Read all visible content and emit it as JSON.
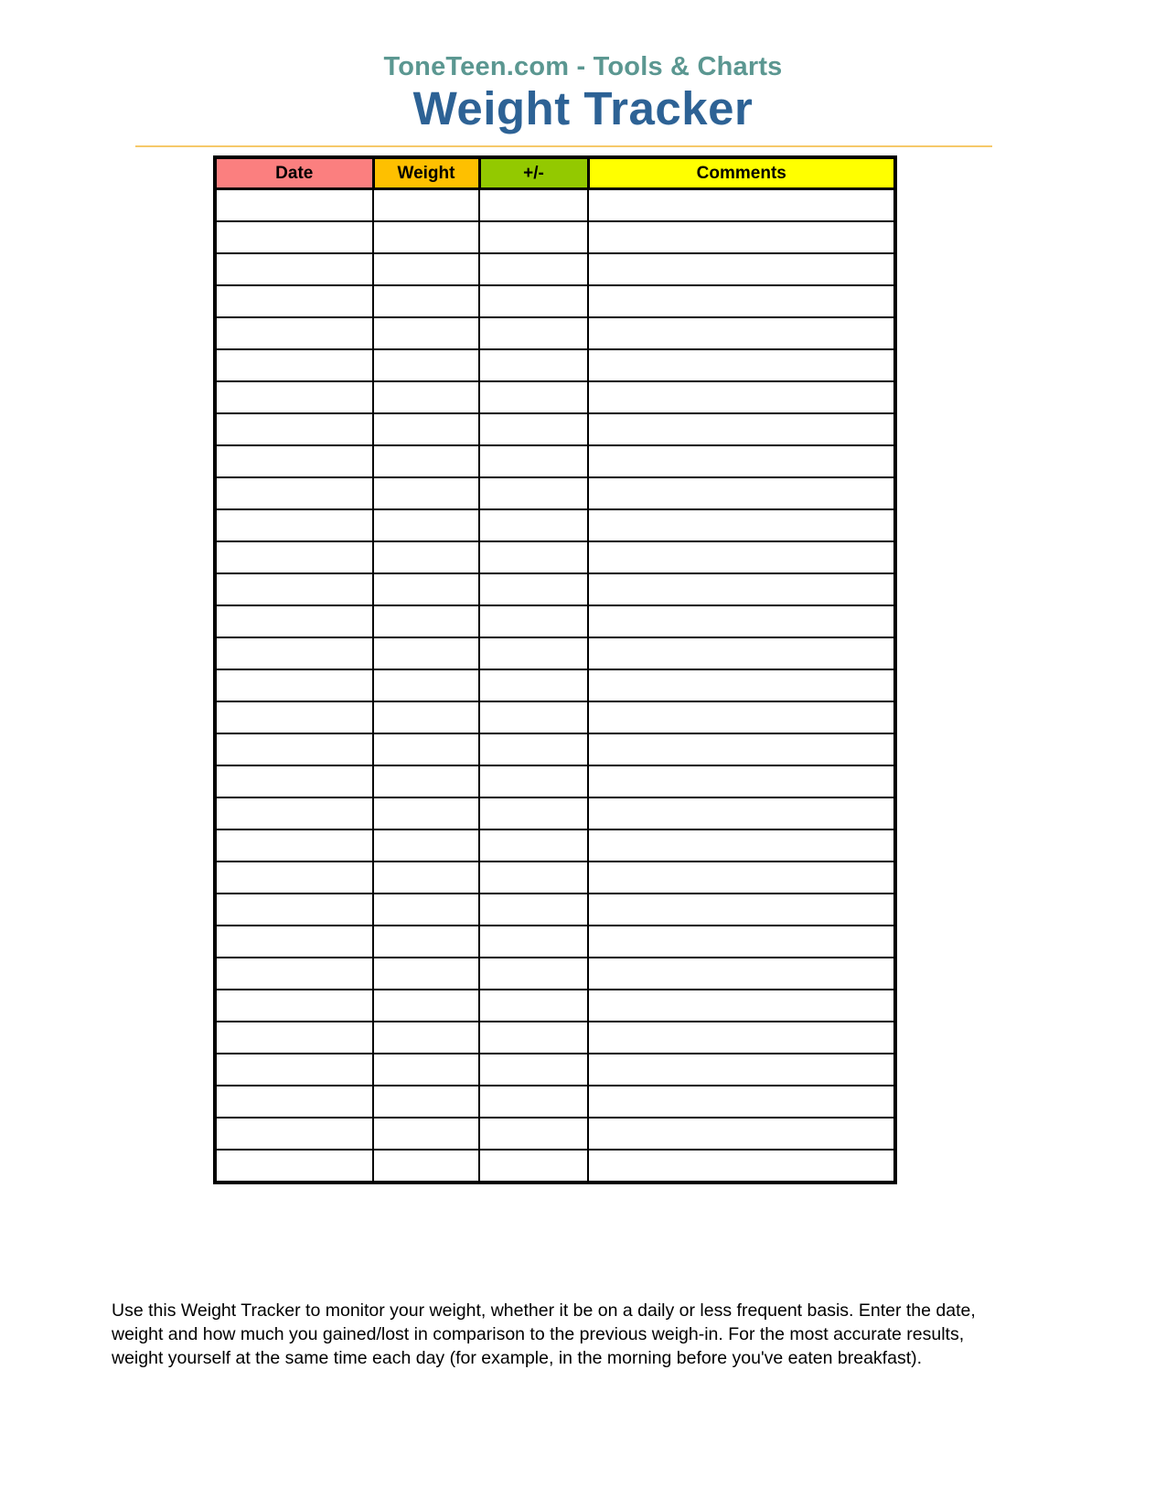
{
  "document": {
    "brand_line": "ToneTeen.com - Tools & Charts",
    "title": "Weight Tracker"
  },
  "theme": {
    "brand_color": "#5b9791",
    "title_color": "#2d6295",
    "rule_color": "#f6c96a",
    "header_date_bg": "#fb7f7f",
    "header_weight_bg": "#fec000",
    "header_delta_bg": "#93c900",
    "header_comments_bg": "#ffff00",
    "grid_color": "#000000",
    "cell_bg": "#ffffff"
  },
  "table": {
    "columns": [
      {
        "key": "date",
        "label": "Date"
      },
      {
        "key": "weight",
        "label": "Weight"
      },
      {
        "key": "delta",
        "label": "+/-"
      },
      {
        "key": "comments",
        "label": "Comments"
      }
    ],
    "row_count": 31,
    "rows": [
      {
        "date": "",
        "weight": "",
        "delta": "",
        "comments": ""
      },
      {
        "date": "",
        "weight": "",
        "delta": "",
        "comments": ""
      },
      {
        "date": "",
        "weight": "",
        "delta": "",
        "comments": ""
      },
      {
        "date": "",
        "weight": "",
        "delta": "",
        "comments": ""
      },
      {
        "date": "",
        "weight": "",
        "delta": "",
        "comments": ""
      },
      {
        "date": "",
        "weight": "",
        "delta": "",
        "comments": ""
      },
      {
        "date": "",
        "weight": "",
        "delta": "",
        "comments": ""
      },
      {
        "date": "",
        "weight": "",
        "delta": "",
        "comments": ""
      },
      {
        "date": "",
        "weight": "",
        "delta": "",
        "comments": ""
      },
      {
        "date": "",
        "weight": "",
        "delta": "",
        "comments": ""
      },
      {
        "date": "",
        "weight": "",
        "delta": "",
        "comments": ""
      },
      {
        "date": "",
        "weight": "",
        "delta": "",
        "comments": ""
      },
      {
        "date": "",
        "weight": "",
        "delta": "",
        "comments": ""
      },
      {
        "date": "",
        "weight": "",
        "delta": "",
        "comments": ""
      },
      {
        "date": "",
        "weight": "",
        "delta": "",
        "comments": ""
      },
      {
        "date": "",
        "weight": "",
        "delta": "",
        "comments": ""
      },
      {
        "date": "",
        "weight": "",
        "delta": "",
        "comments": ""
      },
      {
        "date": "",
        "weight": "",
        "delta": "",
        "comments": ""
      },
      {
        "date": "",
        "weight": "",
        "delta": "",
        "comments": ""
      },
      {
        "date": "",
        "weight": "",
        "delta": "",
        "comments": ""
      },
      {
        "date": "",
        "weight": "",
        "delta": "",
        "comments": ""
      },
      {
        "date": "",
        "weight": "",
        "delta": "",
        "comments": ""
      },
      {
        "date": "",
        "weight": "",
        "delta": "",
        "comments": ""
      },
      {
        "date": "",
        "weight": "",
        "delta": "",
        "comments": ""
      },
      {
        "date": "",
        "weight": "",
        "delta": "",
        "comments": ""
      },
      {
        "date": "",
        "weight": "",
        "delta": "",
        "comments": ""
      },
      {
        "date": "",
        "weight": "",
        "delta": "",
        "comments": ""
      },
      {
        "date": "",
        "weight": "",
        "delta": "",
        "comments": ""
      },
      {
        "date": "",
        "weight": "",
        "delta": "",
        "comments": ""
      },
      {
        "date": "",
        "weight": "",
        "delta": "",
        "comments": ""
      },
      {
        "date": "",
        "weight": "",
        "delta": "",
        "comments": ""
      }
    ]
  },
  "note": {
    "text": "Use this Weight Tracker to monitor your weight, whether it be on a daily or less frequent basis.  Enter the date, weight and how much you gained/lost in comparison to the previous weigh-in.  For the most accurate results, weight yourself at the same time each day (for example, in the morning before you've eaten breakfast)."
  }
}
